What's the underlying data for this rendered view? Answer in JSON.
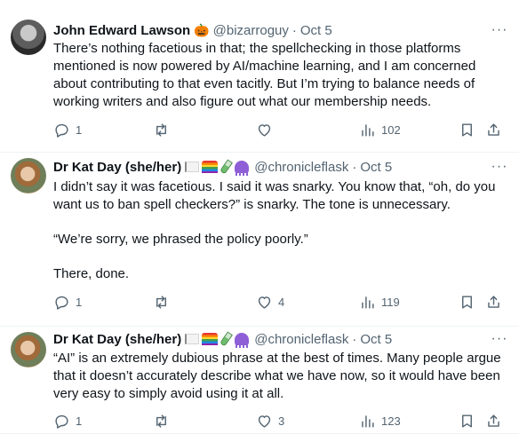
{
  "tweets": [
    {
      "name": "John Edward Lawson",
      "name_emoji": "🎃",
      "handle": "@bizarroguy",
      "dot": "·",
      "date": "Oct 5",
      "paragraphs": [
        "There’s nothing facetious in that; the spellchecking in those platforms mentioned is now powered by AI/machine learning, and I am concerned about contributing to that even tacitly. But I’m trying to balance needs of working writers and also figure out what our membership needs."
      ],
      "replies": "1",
      "retweets": "",
      "likes": "",
      "views": "102",
      "more": "···"
    },
    {
      "name": "Dr Kat Day (she/her)",
      "handle": "@chronicleflask",
      "dot": "·",
      "date": "Oct 5",
      "paragraphs": [
        "I didn’t say it was facetious. I said it was snarky. You know that, “oh, do you want us to ban spell checkers?” is snarky. The tone is unnecessary.",
        "“We’re sorry, we phrased the policy poorly.”",
        "There, done."
      ],
      "replies": "1",
      "retweets": "",
      "likes": "4",
      "views": "119",
      "more": "···"
    },
    {
      "name": "Dr Kat Day (she/her)",
      "handle": "@chronicleflask",
      "dot": "·",
      "date": "Oct 5",
      "paragraphs": [
        "“AI” is an extremely dubious phrase at the best of times. Many people argue that it doesn’t accurately describe what we have now, so it would have been very easy to simply avoid using it at all."
      ],
      "replies": "1",
      "retweets": "",
      "likes": "3",
      "views": "123",
      "more": "···"
    }
  ]
}
